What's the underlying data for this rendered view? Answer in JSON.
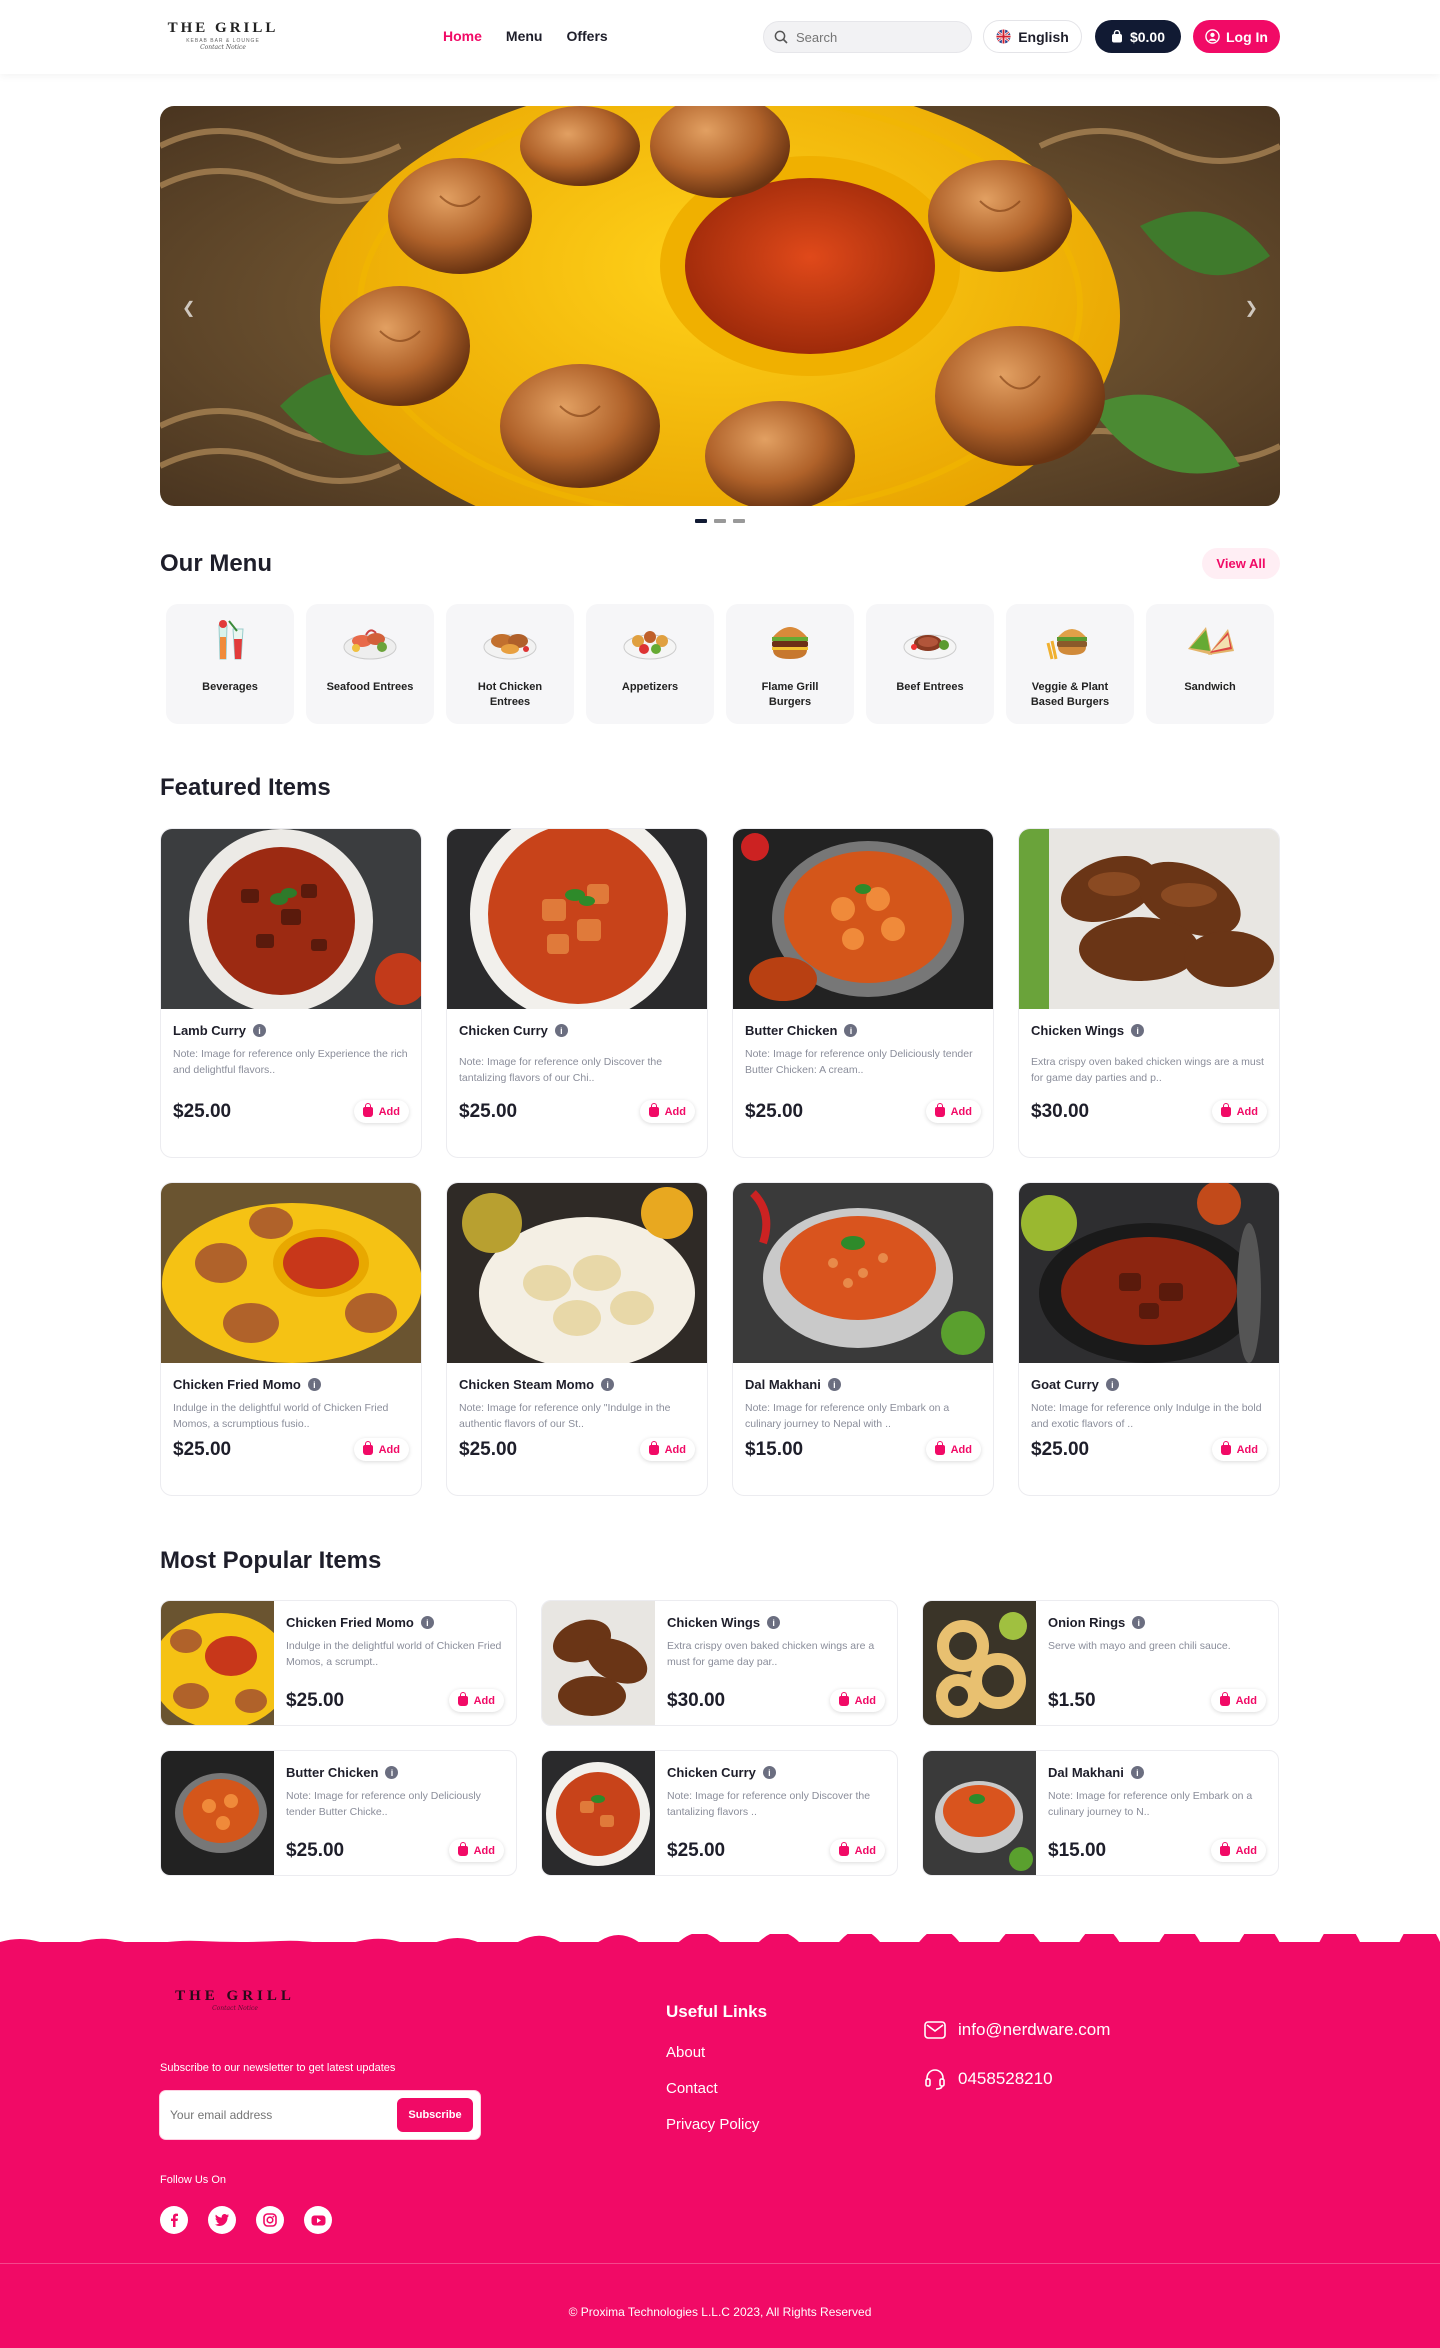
{
  "header": {
    "logo_text": "THE GRILL",
    "logo_tagline": "KEBAB BAR & LOUNGE",
    "logo_script": "Contact Notice",
    "nav": [
      {
        "label": "Home",
        "active": true
      },
      {
        "label": "Menu",
        "active": false
      },
      {
        "label": "Offers",
        "active": false
      }
    ],
    "search_placeholder": "Search",
    "language": "English",
    "cart_total": "$0.00",
    "login_label": "Log In"
  },
  "hero": {
    "slides": 3,
    "active_slide": 0,
    "icon_prev": "chevron-left-icon",
    "icon_next": "chevron-right-icon"
  },
  "menu_section": {
    "title": "Our Menu",
    "view_all": "View All",
    "categories": [
      {
        "label": "Beverages",
        "icon": "beverage-icon"
      },
      {
        "label": "Seafood Entrees",
        "icon": "seafood-icon"
      },
      {
        "label": "Hot Chicken Entrees",
        "icon": "chicken-icon"
      },
      {
        "label": "Appetizers",
        "icon": "appetizer-icon"
      },
      {
        "label": "Flame Grill Burgers",
        "icon": "burger-icon"
      },
      {
        "label": "Beef Entrees",
        "icon": "beef-icon"
      },
      {
        "label": "Veggie & Plant Based Burgers",
        "icon": "veggie-burger-icon"
      },
      {
        "label": "Sandwich",
        "icon": "sandwich-icon"
      }
    ]
  },
  "featured": {
    "title": "Featured Items",
    "items": [
      {
        "name": "Lamb Curry",
        "desc": "Note: Image for reference only Experience the rich and delightful flavors..",
        "price": "$25.00",
        "add": "Add"
      },
      {
        "name": "Chicken Curry",
        "desc": "Note: Image for reference only Discover the tantalizing flavors of our Chi..",
        "price": "$25.00",
        "add": "Add"
      },
      {
        "name": "Butter Chicken",
        "desc": "Note: Image for reference only Deliciously tender Butter Chicken: A cream..",
        "price": "$25.00",
        "add": "Add"
      },
      {
        "name": "Chicken Wings",
        "desc": "Extra crispy oven baked chicken wings are a must for game day parties and p..",
        "price": "$30.00",
        "add": "Add"
      },
      {
        "name": "Chicken Fried Momo",
        "desc": "Indulge in the delightful world of Chicken Fried Momos, a scrumptious fusio..",
        "price": "$25.00",
        "add": "Add"
      },
      {
        "name": "Chicken Steam Momo",
        "desc": "Note: Image for reference only \"Indulge in the authentic flavors of our St..",
        "price": "$25.00",
        "add": "Add"
      },
      {
        "name": "Dal Makhani",
        "desc": "Note: Image for reference only Embark on a culinary journey to Nepal with ..",
        "price": "$15.00",
        "add": "Add"
      },
      {
        "name": "Goat Curry",
        "desc": "Note: Image for reference only Indulge in the bold and exotic flavors of ..",
        "price": "$25.00",
        "add": "Add"
      }
    ]
  },
  "popular": {
    "title": "Most Popular Items",
    "items": [
      {
        "name": "Chicken Fried Momo",
        "desc": "Indulge in the delightful world of Chicken Fried Momos, a scrumpt..",
        "price": "$25.00",
        "add": "Add"
      },
      {
        "name": "Chicken Wings",
        "desc": "Extra crispy oven baked chicken wings are a must for game day par..",
        "price": "$30.00",
        "add": "Add"
      },
      {
        "name": "Onion Rings",
        "desc": "Serve with mayo and green chili sauce.",
        "price": "$1.50",
        "add": "Add"
      },
      {
        "name": "Butter Chicken",
        "desc": "Note: Image for reference only Deliciously tender Butter Chicke..",
        "price": "$25.00",
        "add": "Add"
      },
      {
        "name": "Chicken Curry",
        "desc": "Note: Image for reference only Discover the tantalizing flavors ..",
        "price": "$25.00",
        "add": "Add"
      },
      {
        "name": "Dal Makhani",
        "desc": "Note: Image for reference only Embark on a culinary journey to N..",
        "price": "$15.00",
        "add": "Add"
      }
    ]
  },
  "footer": {
    "logo_text": "THE GRILL",
    "logo_script": "Contact Notice",
    "newsletter_text": "Subscribe to our newsletter to get latest updates",
    "email_placeholder": "Your email address",
    "subscribe": "Subscribe",
    "follow": "Follow Us On",
    "socials": [
      "facebook-icon",
      "twitter-icon",
      "instagram-icon",
      "youtube-icon"
    ],
    "useful_links_title": "Useful Links",
    "links": [
      "About",
      "Contact",
      "Privacy Policy"
    ],
    "email": "info@nerdware.com",
    "phone": "0458528210",
    "copyright": "© Proxima Technologies L.L.C 2023, All Rights Reserved"
  },
  "colors": {
    "brand": "#f10a66",
    "navy": "#111a33",
    "text": "#1e1e2a",
    "muted": "#8a8d9a"
  }
}
